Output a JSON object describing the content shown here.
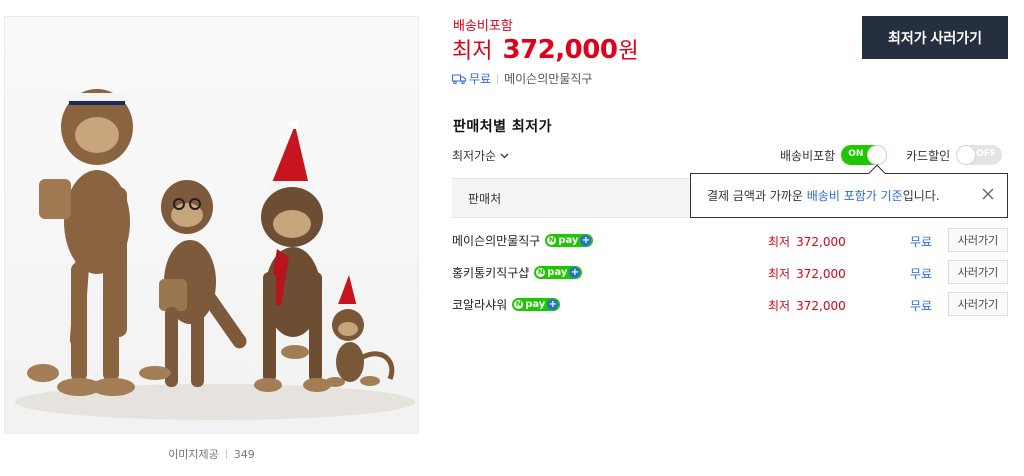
{
  "image": {
    "credit_label": "이미지제공",
    "credit_value": "349"
  },
  "price": {
    "shipping_included": "배송비포함",
    "label": "최저",
    "value": "372,000",
    "unit": "원"
  },
  "delivery": {
    "fee": "무료",
    "seller": "메이슨의만물직구"
  },
  "buy_button": "최저가 사러가기",
  "section_title": "판매처별 최저가",
  "sort": {
    "selected": "최저가순"
  },
  "toggles": [
    {
      "label": "배송비포함",
      "state_text": "ON",
      "on": true
    },
    {
      "label": "카드할인",
      "state_text": "OFF",
      "on": false
    }
  ],
  "table": {
    "col_seller": "판매처"
  },
  "tooltip": {
    "prefix": "결제 금액과 가까운 ",
    "highlight": "배송비 포함가 기준",
    "suffix": "입니다."
  },
  "npay_badge": {
    "n": "N",
    "pay": "pay",
    "plus": "+"
  },
  "rows": [
    {
      "seller": "메이슨의만물직구",
      "price_label": "최저",
      "price": "372,000",
      "shipping": "무료",
      "action": "사러가기"
    },
    {
      "seller": "홍키통키직구샵",
      "price_label": "최저",
      "price": "372,000",
      "shipping": "무료",
      "action": "사러가기"
    },
    {
      "seller": "코알라샤워",
      "price_label": "최저",
      "price": "372,000",
      "shipping": "무료",
      "action": "사러가기"
    }
  ],
  "colors": {
    "accent_red": "#e0001b",
    "naver_green": "#1ec800",
    "link_blue": "#2b6bd8",
    "button_navy": "#262f3f"
  }
}
